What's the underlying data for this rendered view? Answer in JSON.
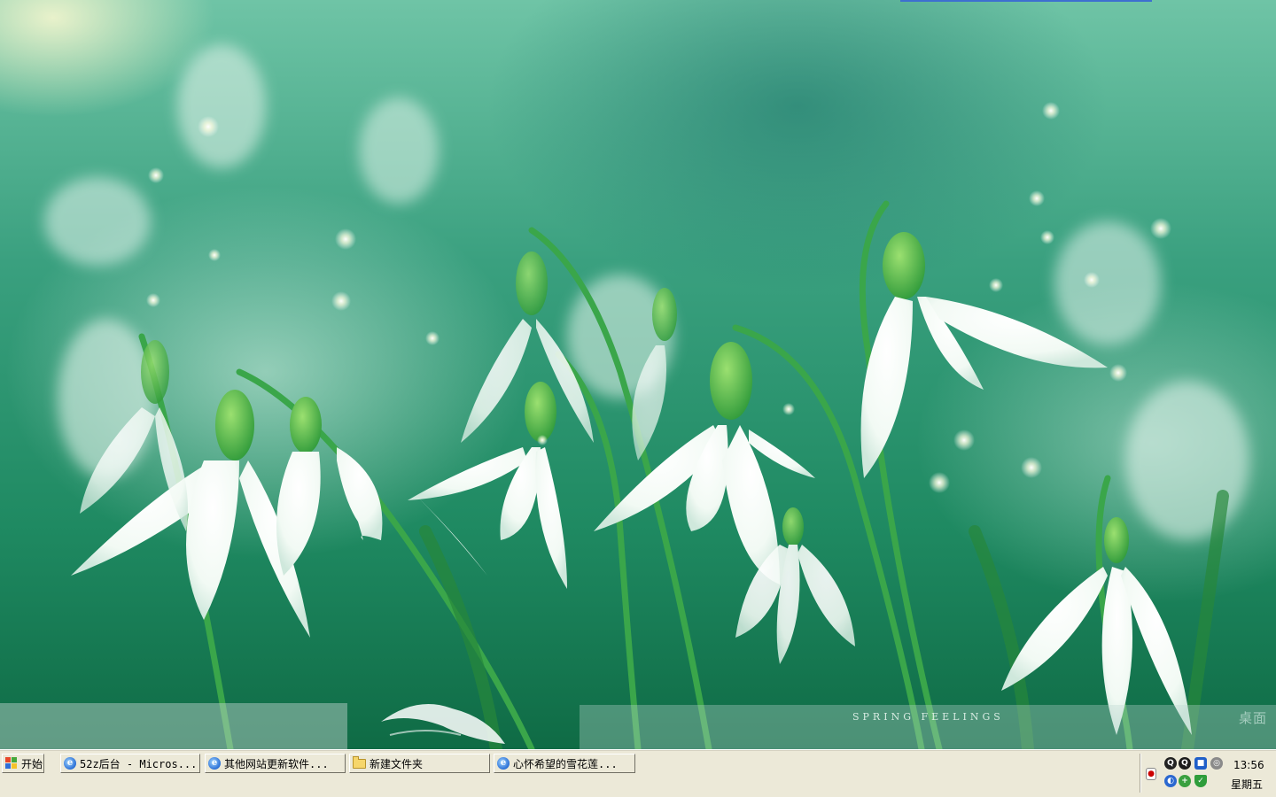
{
  "wallpaper": {
    "caption": "SPRING FEELINGS",
    "watermark": "桌面"
  },
  "taskbar": {
    "start_label": "开始",
    "tasks": [
      {
        "label": "52z后台 - Micros...",
        "icon": "ie-icon"
      },
      {
        "label": "其他网站更新软件...",
        "icon": "ie-icon"
      },
      {
        "label": "新建文件夹",
        "icon": "folder-icon"
      },
      {
        "label": "心怀希望的雪花莲...",
        "icon": "ie-icon"
      }
    ],
    "tray": {
      "icons": [
        "network-icon",
        "qq-icon",
        "qq-icon",
        "app-icon",
        "volume-icon",
        "browser-icon",
        "update-icon",
        "security-shield-icon",
        "input-method-icon"
      ],
      "time": "13:56",
      "day": "星期五"
    }
  },
  "colors": {
    "taskbar_bg": "#ece9d8",
    "wallpaper_green": "#2e9a72"
  }
}
